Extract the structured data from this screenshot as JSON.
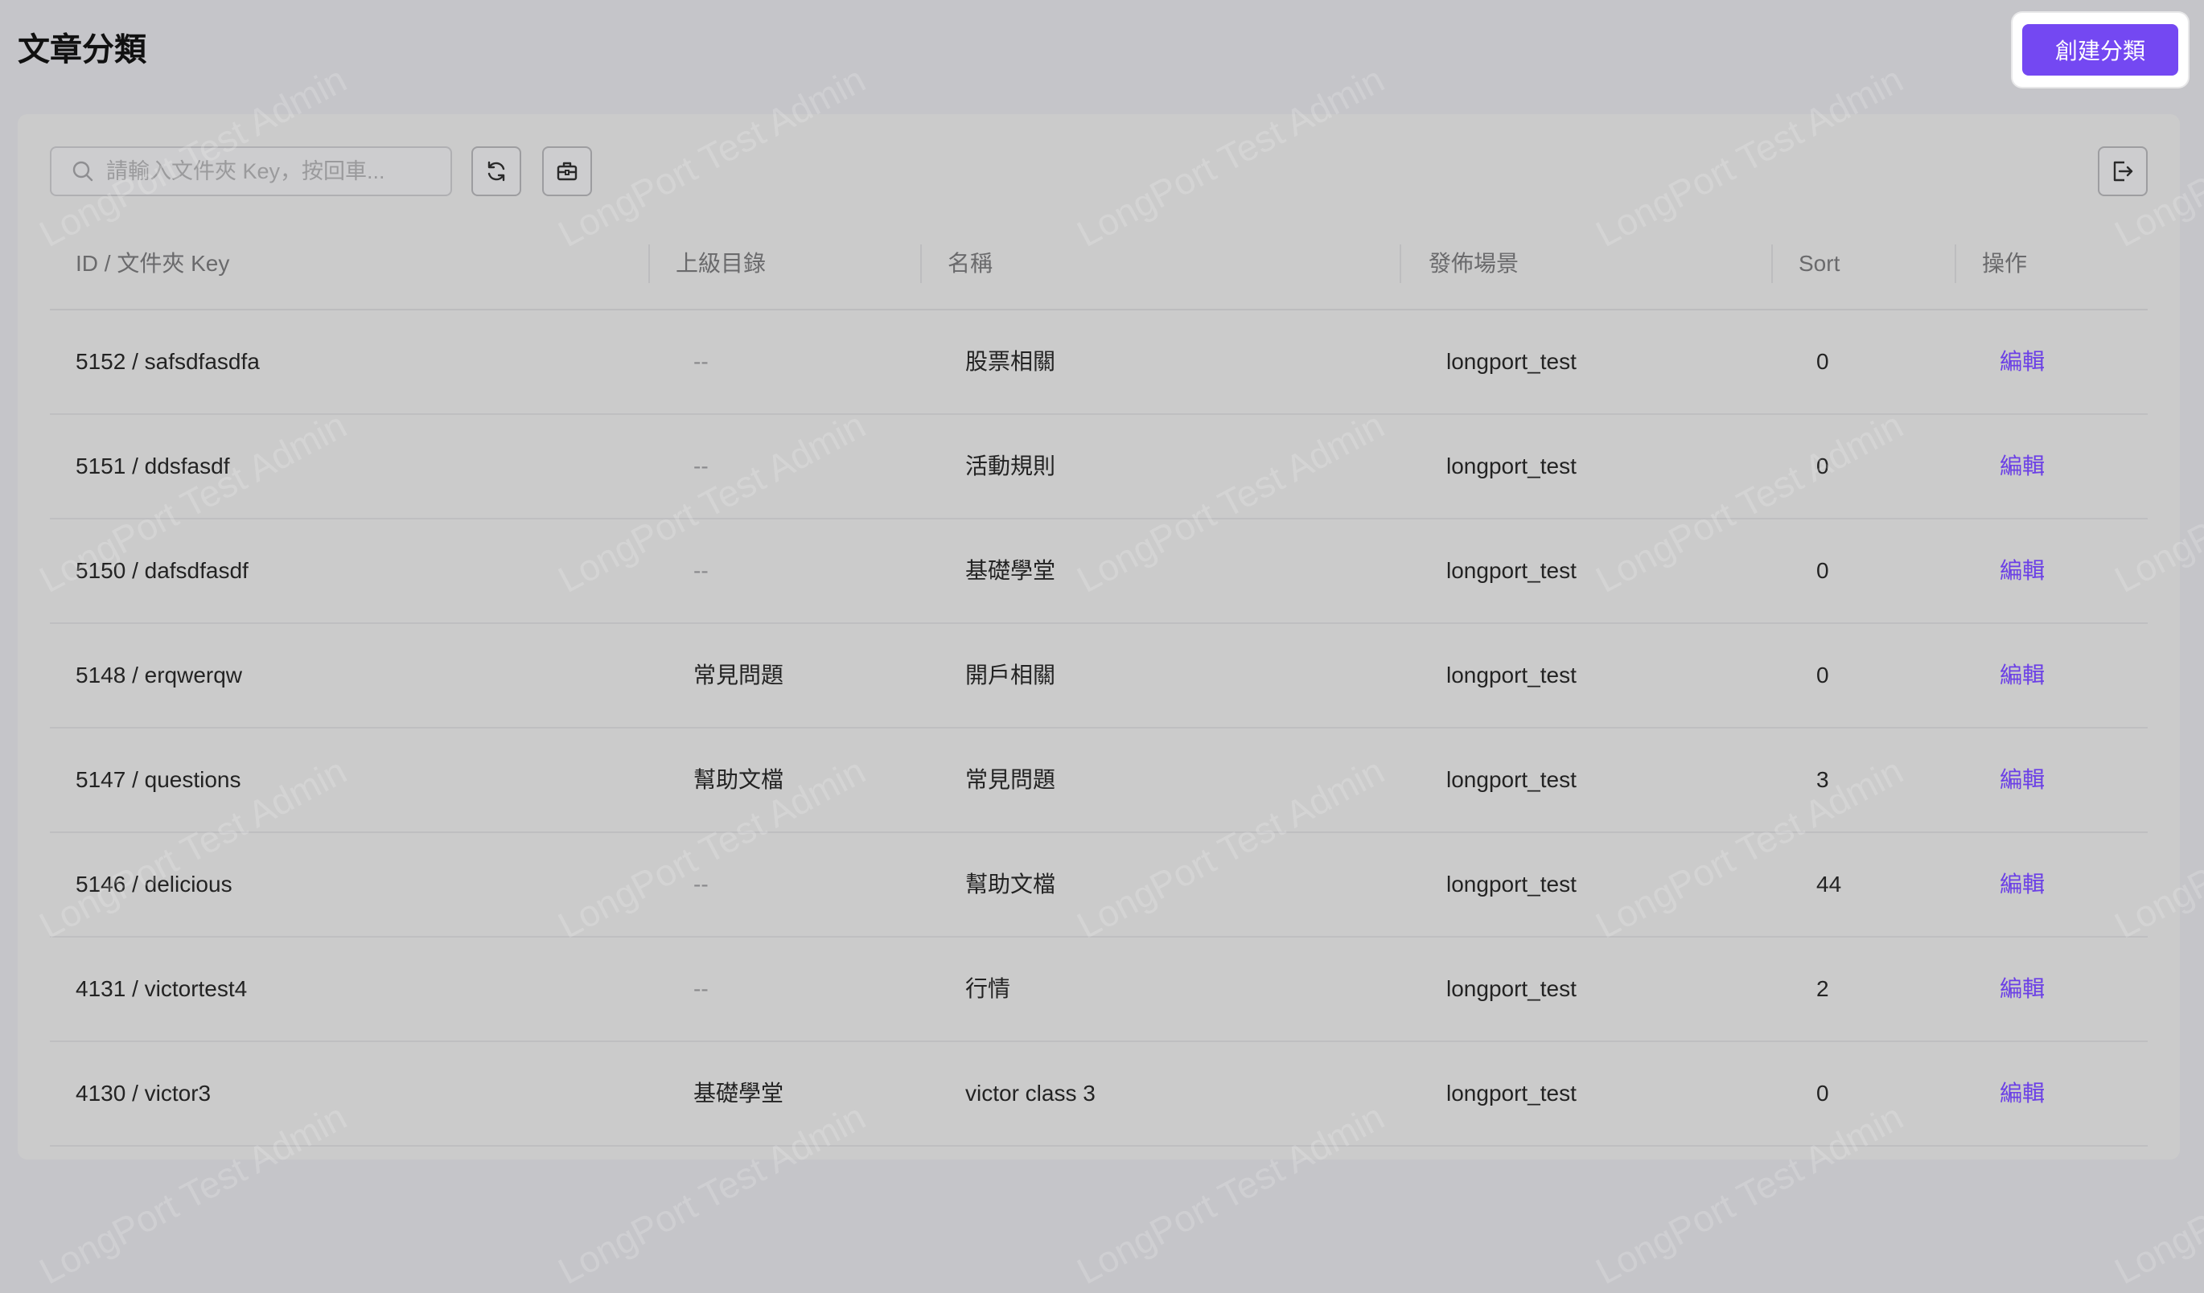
{
  "header": {
    "title": "文章分類",
    "create_button_label": "創建分類"
  },
  "toolbar": {
    "search_placeholder": "請輸入文件夾 Key，按回車...",
    "search_value": ""
  },
  "watermark_text": "LongPort Test Admin",
  "table": {
    "columns": [
      "ID / 文件夾 Key",
      "上級目錄",
      "名稱",
      "發佈場景",
      "Sort",
      "操作"
    ],
    "rows": [
      {
        "id_key": "5152 / safsdfasdfa",
        "parent": "--",
        "name": "股票相關",
        "scene": "longport_test",
        "sort": "0",
        "action": "編輯"
      },
      {
        "id_key": "5151 / ddsfasdf",
        "parent": "--",
        "name": "活動規則",
        "scene": "longport_test",
        "sort": "0",
        "action": "編輯"
      },
      {
        "id_key": "5150 / dafsdfasdf",
        "parent": "--",
        "name": "基礎學堂",
        "scene": "longport_test",
        "sort": "0",
        "action": "編輯"
      },
      {
        "id_key": "5148 / erqwerqw",
        "parent": "常見問題",
        "name": "開戶相關",
        "scene": "longport_test",
        "sort": "0",
        "action": "編輯"
      },
      {
        "id_key": "5147 / questions",
        "parent": "幫助文檔",
        "name": "常見問題",
        "scene": "longport_test",
        "sort": "3",
        "action": "編輯"
      },
      {
        "id_key": "5146 / delicious",
        "parent": "--",
        "name": "幫助文檔",
        "scene": "longport_test",
        "sort": "44",
        "action": "編輯"
      },
      {
        "id_key": "4131 / victortest4",
        "parent": "--",
        "name": "行情",
        "scene": "longport_test",
        "sort": "2",
        "action": "編輯"
      },
      {
        "id_key": "4130 / victor3",
        "parent": "基礎學堂",
        "name": "victor class 3",
        "scene": "longport_test",
        "sort": "0",
        "action": "編輯"
      }
    ]
  }
}
